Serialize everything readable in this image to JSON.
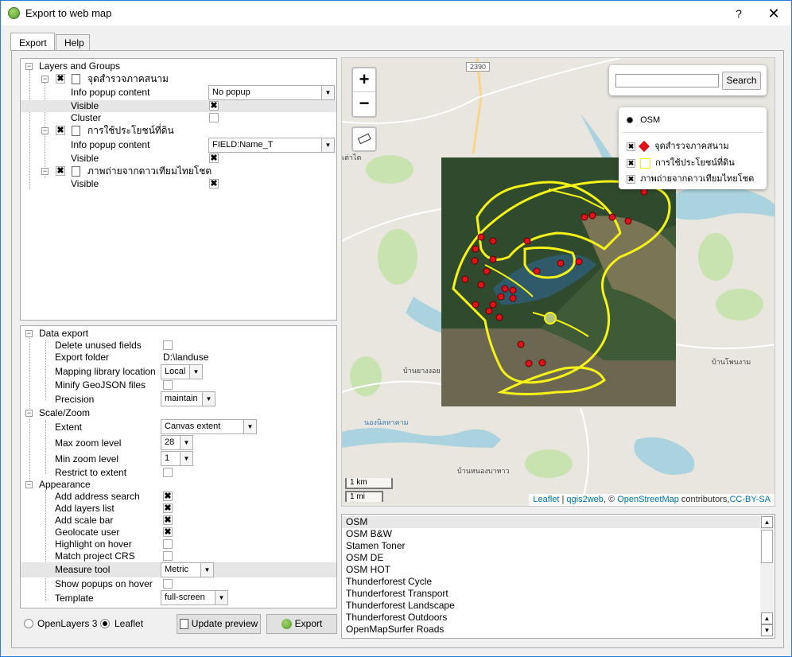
{
  "window": {
    "title": "Export to web map",
    "help_glyph": "?",
    "close_glyph": "✕"
  },
  "tabs": [
    "Export",
    "Help"
  ],
  "layers_tree": {
    "header": "Layers and Groups",
    "layers": [
      {
        "name": "จุดสำรวจภาคสนาม",
        "checked": true,
        "props": [
          {
            "label": "Info popup content",
            "type": "combo",
            "value": "No popup"
          },
          {
            "label": "Visible",
            "type": "check",
            "value": true
          },
          {
            "label": "Cluster",
            "type": "check",
            "value": false
          }
        ]
      },
      {
        "name": "การใช้ประโยชน์ที่ดิน",
        "checked": true,
        "props": [
          {
            "label": "Info popup content",
            "type": "combo",
            "value": "FIELD:Name_T"
          },
          {
            "label": "Visible",
            "type": "check",
            "value": true
          }
        ]
      },
      {
        "name": "ภาพถ่ายจากดาวเทียมไทยโชต",
        "checked": true,
        "props": [
          {
            "label": "Visible",
            "type": "check",
            "value": true
          }
        ]
      }
    ]
  },
  "settings": {
    "data_export": {
      "header": "Data export",
      "delete_unused_fields": {
        "label": "Delete unused fields",
        "value": false
      },
      "export_folder": {
        "label": "Export folder",
        "value": "D:\\landuse"
      },
      "mapping_library_location": {
        "label": "Mapping library location",
        "value": "Local"
      },
      "minify_geojson": {
        "label": "Minify GeoJSON files",
        "value": false
      },
      "precision": {
        "label": "Precision",
        "value": "maintain"
      }
    },
    "scale_zoom": {
      "header": "Scale/Zoom",
      "extent": {
        "label": "Extent",
        "value": "Canvas extent"
      },
      "max_zoom": {
        "label": "Max zoom level",
        "value": "28"
      },
      "min_zoom": {
        "label": "Min zoom level",
        "value": "1"
      },
      "restrict_to_extent": {
        "label": "Restrict to extent",
        "value": false
      }
    },
    "appearance": {
      "header": "Appearance",
      "add_address_search": {
        "label": "Add address search",
        "value": true
      },
      "add_layers_list": {
        "label": "Add layers list",
        "value": true
      },
      "add_scale_bar": {
        "label": "Add scale bar",
        "value": true
      },
      "geolocate_user": {
        "label": "Geolocate user",
        "value": true
      },
      "highlight_on_hover": {
        "label": "Highlight on hover",
        "value": false
      },
      "match_project_crs": {
        "label": "Match project CRS",
        "value": false
      },
      "measure_tool": {
        "label": "Measure tool",
        "value": "Metric"
      },
      "show_popups_on_hover": {
        "label": "Show popups on hover",
        "value": false
      },
      "template": {
        "label": "Template",
        "value": "full-screen"
      }
    }
  },
  "bottom": {
    "radio_openlayers": "OpenLayers 3",
    "radio_leaflet": "Leaflet",
    "selected": "Leaflet",
    "update_preview": "Update preview",
    "export": "Export"
  },
  "map": {
    "zoom_in": "+",
    "zoom_out": "−",
    "search_button": "Search",
    "search_placeholder": "",
    "layers_control": {
      "basemap": "OSM",
      "overlays": [
        "จุดสำรวจภาคสนาม",
        "การใช้ประโยชน์ที่ดิน",
        "ภาพถ่ายจากดาวเทียมไทยโชต"
      ]
    },
    "scale_km": "1 km",
    "scale_mi": "1 mi",
    "attribution": {
      "leaflet": "Leaflet",
      "sep": " | ",
      "qgis2web": "qgis2web",
      "copy": ", © ",
      "osm": "OpenStreetMap",
      "contrib": " contributors,",
      "license": "CC-BY-SA"
    },
    "labels": {
      "road": "2390",
      "town_1": "บ้านยางงอย",
      "town_2": "บ้านโพนงาม",
      "town_3": "บ้านหนองบาทาว",
      "town_4": "เต่าไต",
      "town_5": "นองนิลหาคาม"
    },
    "colors": {
      "boundary": "#f5f219",
      "point": "#e0131a"
    }
  },
  "basemaps": [
    "OSM",
    "OSM B&W",
    "Stamen Toner",
    "OSM DE",
    "OSM HOT",
    "Thunderforest Cycle",
    "Thunderforest Transport",
    "Thunderforest Landscape",
    "Thunderforest Outdoors",
    "OpenMapSurfer Roads"
  ]
}
